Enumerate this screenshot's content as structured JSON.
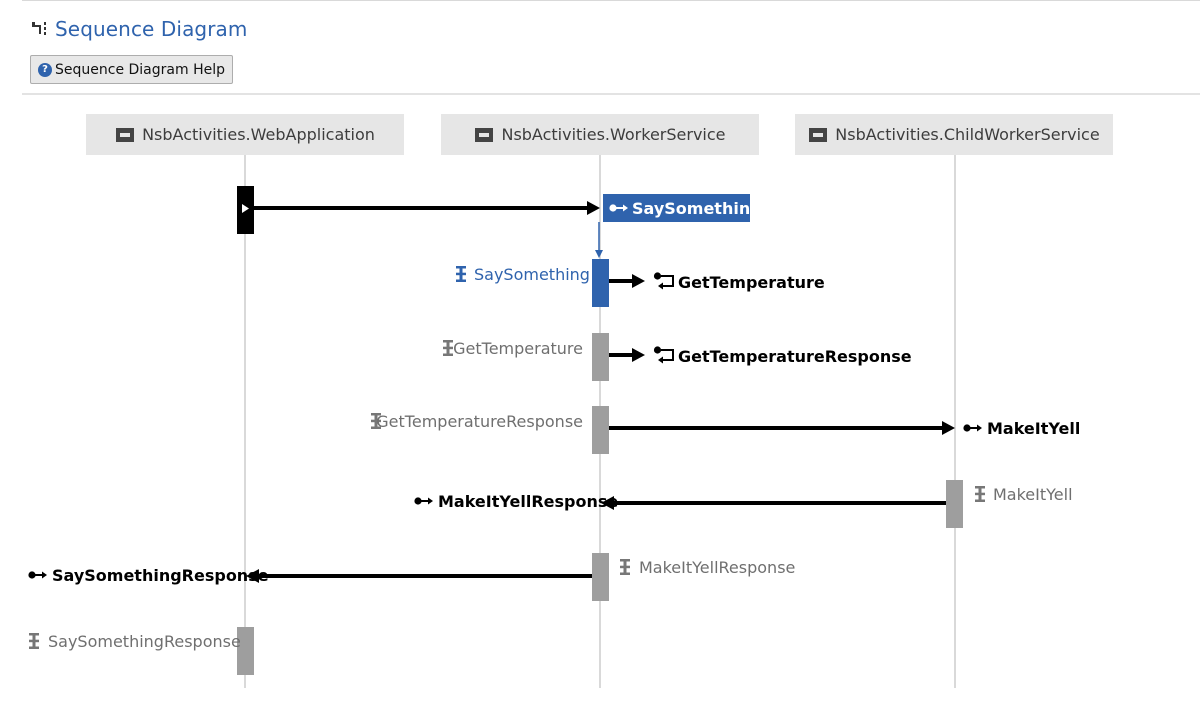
{
  "header": {
    "title": "Sequence Diagram",
    "help_button": "Sequence Diagram Help",
    "help_icon_glyph": "?"
  },
  "colors": {
    "accent": "#2f63ad",
    "lifeline": "#d9d9d9",
    "handler_bar": "#9e9e9e",
    "arrow": "#000000",
    "endpoint_bg": "#e6e6e6"
  },
  "endpoints": [
    {
      "name": "NsbActivities.WebApplication",
      "icon": "endpoint-icon"
    },
    {
      "name": "NsbActivities.WorkerService",
      "icon": "endpoint-icon"
    },
    {
      "name": "NsbActivities.ChildWorkerService",
      "icon": "endpoint-icon"
    }
  ],
  "messages": [
    {
      "label": "SaySomething",
      "kind": "command",
      "from": 0,
      "to": 1,
      "selected": true
    },
    {
      "label": "GetTemperature",
      "kind": "local",
      "from": 1,
      "to": 1
    },
    {
      "label": "GetTemperatureResponse",
      "kind": "local",
      "from": 1,
      "to": 1
    },
    {
      "label": "MakeItYell",
      "kind": "command",
      "from": 1,
      "to": 2
    },
    {
      "label": "MakeItYellResponse",
      "kind": "command",
      "from": 2,
      "to": 1
    },
    {
      "label": "SaySomethingResponse",
      "kind": "command",
      "from": 1,
      "to": 0
    }
  ],
  "handlers": [
    {
      "label": "SaySomething",
      "endpoint": 1,
      "selected": true
    },
    {
      "label": "GetTemperature",
      "endpoint": 1
    },
    {
      "label": "GetTemperatureResponse",
      "endpoint": 1
    },
    {
      "label": "MakeItYell",
      "endpoint": 2
    },
    {
      "label": "MakeItYellResponse",
      "endpoint": 1
    },
    {
      "label": "SaySomethingResponse",
      "endpoint": 0
    }
  ]
}
